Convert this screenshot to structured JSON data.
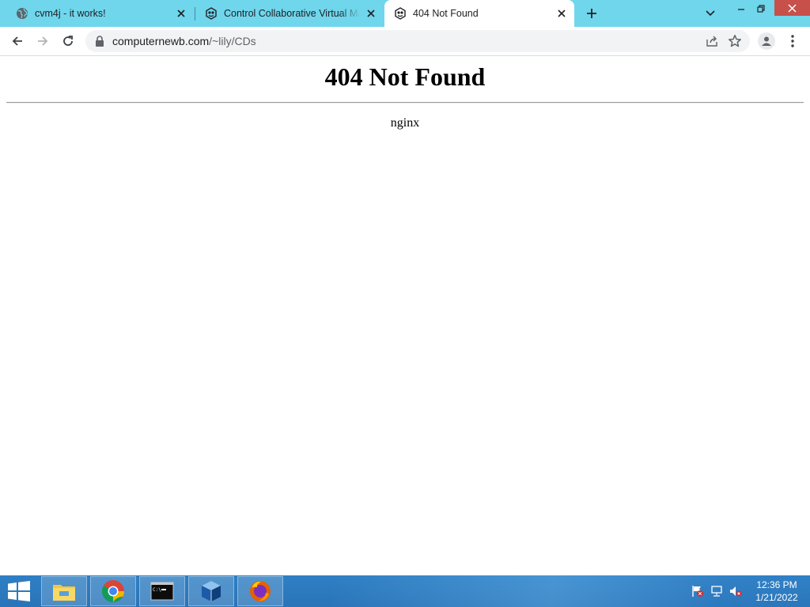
{
  "browser": {
    "tabs": [
      {
        "title": "cvm4j - it works!",
        "icon": "globe-icon"
      },
      {
        "title": "Control Collaborative Virtual Machine",
        "icon": "cvm-logo-icon"
      },
      {
        "title": "404 Not Found",
        "icon": "cvm-logo-icon",
        "active": true
      }
    ],
    "address": {
      "host": "computernewb.com",
      "path": "/~lily/CDs"
    }
  },
  "page": {
    "heading": "404 Not Found",
    "server": "nginx"
  },
  "taskbar": {
    "pinned": [
      "file-explorer-icon",
      "chrome-icon",
      "command-prompt-icon",
      "virtualbox-icon",
      "firefox-icon"
    ],
    "clock": {
      "time": "12:36 PM",
      "date": "1/21/2022"
    }
  },
  "colors": {
    "tabstrip": "#6fd6ec",
    "taskbar": "#2a74b8",
    "close_button": "#c7504a"
  }
}
